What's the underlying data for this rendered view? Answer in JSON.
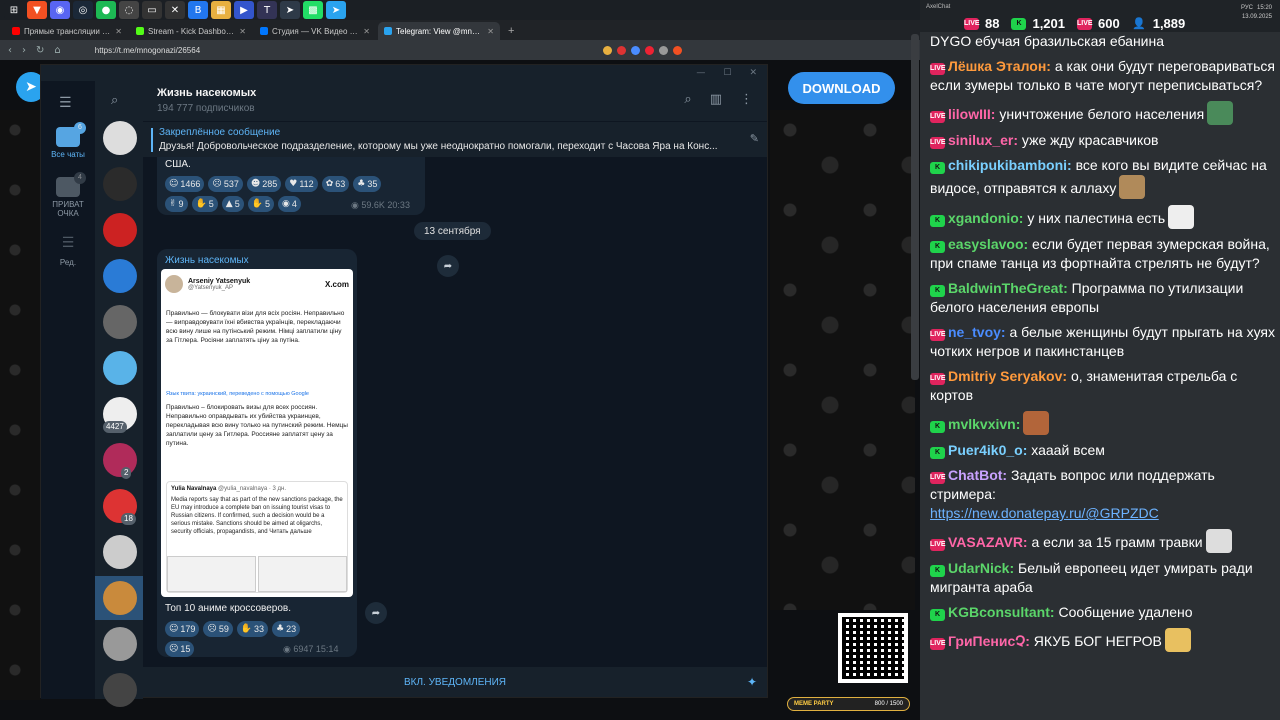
{
  "taskbar": {
    "icons": [
      {
        "name": "windows-icon",
        "glyph": "⊞",
        "color": "#1b1f24"
      },
      {
        "name": "brave-icon",
        "glyph": "▼",
        "color": "#f25022"
      },
      {
        "name": "discord-icon",
        "glyph": "◉",
        "color": "#5865f2"
      },
      {
        "name": "steam-icon",
        "glyph": "◎",
        "color": "#1b2838"
      },
      {
        "name": "spotify-icon",
        "glyph": "●",
        "color": "#1db954"
      },
      {
        "name": "obs-icon",
        "glyph": "◌",
        "color": "#444"
      },
      {
        "name": "window-icon",
        "glyph": "▭",
        "color": "#333"
      },
      {
        "name": "app-x-icon",
        "glyph": "✕",
        "color": "#333"
      },
      {
        "name": "app-b-icon",
        "glyph": "B",
        "color": "#2277ee"
      },
      {
        "name": "app-folder-icon",
        "glyph": "▦",
        "color": "#e8b040"
      },
      {
        "name": "app-arrow-icon",
        "glyph": "▶",
        "color": "#3355cc"
      },
      {
        "name": "app-t-icon",
        "glyph": "T",
        "color": "#335"
      },
      {
        "name": "telegram-icon",
        "glyph": "➤",
        "color": "#2aa3ef"
      },
      {
        "name": "app-grid-icon",
        "glyph": "▩",
        "color": "#2d6"
      },
      {
        "name": "telegram-2-icon",
        "glyph": "➤",
        "color": "#2aa3ef"
      }
    ]
  },
  "browser": {
    "tabs": [
      {
        "label": "Прямые трансляции - YouTube Studio",
        "color": "#ff0000",
        "active": false
      },
      {
        "label": "Stream - Kick Dashboard",
        "color": "#53fc18",
        "active": false
      },
      {
        "label": "Студия — VK Видео Live",
        "color": "#0077ff",
        "active": false
      },
      {
        "label": "Telegram: View @mnogonazi",
        "color": "#2aa3ef",
        "active": true
      }
    ],
    "new_tab": "+",
    "url": "https://t.me/mnogonazi/26564",
    "back": "‹",
    "forward": "›",
    "reload": "↻",
    "home": "⌂"
  },
  "page": {
    "download_label": "DOWNLOAD",
    "meme_party": "MEME PARTY",
    "meme_count": "800 / 1500"
  },
  "telegram": {
    "window_controls": {
      "minimize": "—",
      "maximize": "☐",
      "close": "✕"
    },
    "rail": {
      "menu": "☰",
      "items": [
        {
          "label": "Все чаты",
          "badge": "6",
          "active": true
        },
        {
          "label": "ПРИВАТ ОЧКА",
          "badge": "4",
          "active": false
        },
        {
          "label": "Ред.",
          "badge": "",
          "active": false
        }
      ]
    },
    "chat_list": {
      "search": "⌕",
      "avatars": [
        {
          "color": "#ddd",
          "badge": ""
        },
        {
          "color": "#2b2b2b",
          "badge": ""
        },
        {
          "color": "#c22",
          "badge": ""
        },
        {
          "color": "#2a7bd6",
          "badge": ""
        },
        {
          "color": "#666",
          "badge": ""
        },
        {
          "color": "#59b3e8",
          "badge": ""
        },
        {
          "color": "#eee",
          "badge": "4427"
        },
        {
          "color": "#b02b5a",
          "badge": "2"
        },
        {
          "color": "#d33",
          "badge": "18"
        },
        {
          "color": "#ccc",
          "badge": ""
        },
        {
          "color": "#c98a3c",
          "badge": ""
        },
        {
          "color": "#999",
          "badge": ""
        },
        {
          "color": "#444",
          "badge": ""
        }
      ]
    },
    "header": {
      "title": "Жизнь насекомых",
      "subscribers": "194 777 подписчиков",
      "search": "⌕",
      "columns": "▥",
      "more": "⋮"
    },
    "pinned": {
      "title": "Закреплённое сообщение",
      "text": "Друзья!  Добровольческое подразделение, которому мы уже неоднократно помогали, переходит с Часова Яра на Конс...",
      "icon": "✎"
    },
    "msg1": {
      "text": "США.",
      "reactions_row1": [
        {
          "emoji": "☺",
          "count": "1466"
        },
        {
          "emoji": "☹",
          "count": "537"
        },
        {
          "emoji": "☻",
          "count": "285"
        },
        {
          "emoji": "♥",
          "count": "112"
        },
        {
          "emoji": "✿",
          "count": "63"
        },
        {
          "emoji": "♣",
          "count": "35"
        }
      ],
      "reactions_row2": [
        {
          "emoji": "✌",
          "count": "9"
        },
        {
          "emoji": "✋",
          "count": "5"
        },
        {
          "emoji": "▲",
          "count": "5"
        },
        {
          "emoji": "✋",
          "count": "5"
        },
        {
          "emoji": "◉",
          "count": "4"
        }
      ],
      "views": "59.6K",
      "time": "20:33",
      "forward": "➦"
    },
    "date": "13 сентября",
    "msg2": {
      "author": "Жизнь насекомых",
      "tweet": {
        "name": "Arseniy Yatsenyuk",
        "handle": "@Yatsenyuk_AP",
        "source": "X.com",
        "ua_text": "Правильно — блокувати візи для всіх росіян. Неправильно — виправдовувати їхні вбивства українців, перекладаючи всю вину лише на путінський режим. Німці заплатили ціну за Гітлера. Росіяни заплатять ціну за путіна.",
        "translate_note": "Язык твита: украинский, переведено с помощью Google",
        "ru_text": "Правильно – блокировать визы для всех россиян. Неправильно оправдывать их убийства украинцев, перекладывая всю вину только на путинский режим. Немцы заплатили цену за Гитлера. Россияне заплатят цену за путина.",
        "quote_name": "Yulia Navalnaya",
        "quote_handle": "@yulia_navalnaya · 3 дн.",
        "quote_text": "Media reports say that as part of the new sanctions package, the EU may introduce a complete ban on issuing tourist visas to Russian citizens. If confirmed, such a decision would be a serious mistake. Sanctions should be aimed at oligarchs, security officials, propagandists, and Читать дальше"
      },
      "caption": "Топ 10 аниме кроссоверов.",
      "reactions_row1": [
        {
          "emoji": "☺",
          "count": "179"
        },
        {
          "emoji": "☹",
          "count": "59"
        },
        {
          "emoji": "✋",
          "count": "33"
        },
        {
          "emoji": "♣",
          "count": "23"
        }
      ],
      "reactions_row2": [
        {
          "emoji": "☹",
          "count": "15"
        }
      ],
      "views": "6947",
      "time": "15:14",
      "forward": "➦"
    },
    "notify_label": "ВКЛ. УВЕДОМЛЕНИЯ",
    "gift": "✦"
  },
  "chatpanel": {
    "app_name": "AxelChat",
    "stats": [
      {
        "icon": "live",
        "value": "88"
      },
      {
        "icon": "kick",
        "value": "1,201"
      },
      {
        "icon": "live",
        "value": "600"
      },
      {
        "icon": "viewers",
        "value": "1,889"
      }
    ],
    "sys": {
      "lang": "РУС",
      "time": "15:20",
      "date": "13.09.2025"
    },
    "colors": {
      "live": "#e0245e",
      "kick": "#1fd34b",
      "link": "#6db3ff"
    },
    "messages": [
      {
        "platform": "",
        "nick": "",
        "nick_color": "#ffffff",
        "text": "DYGO ебучая бразильская ебанина",
        "emote": ""
      },
      {
        "platform": "live",
        "nick": "Лёшка Эталон:",
        "nick_color": "#ff9a3c",
        "text": " а как они будут переговариваться если зумеры только в чате могут переписываться?",
        "emote": ""
      },
      {
        "platform": "live",
        "nick": "lilowIII:",
        "nick_color": "#ff66a8",
        "text": " уничтожение белого населения",
        "emote": "#4a8a5a"
      },
      {
        "platform": "live",
        "nick": "sinilux_er:",
        "nick_color": "#ff66a8",
        "text": " уже жду красавчиков",
        "emote": ""
      },
      {
        "platform": "kick",
        "nick": "chikipukibamboni:",
        "nick_color": "#7ad0ff",
        "text": " все кого вы видите сейчас на видосе, отправятся к аллаху",
        "emote": "#b08a5a"
      },
      {
        "platform": "kick",
        "nick": "xgandonio:",
        "nick_color": "#5bd66a",
        "text": " у них палестина есть",
        "emote": "#eeeeee"
      },
      {
        "platform": "kick",
        "nick": "easyslavoo:",
        "nick_color": "#5bd66a",
        "text": " если будет первая зумерская война, при спаме танца из фортнайта стрелять не будут?",
        "emote": ""
      },
      {
        "platform": "kick",
        "nick": "BaldwinTheGreat:",
        "nick_color": "#5bd66a",
        "text": " Программа по утилизации белого населения европы",
        "emote": ""
      },
      {
        "platform": "live",
        "nick": "ne_tvoy:",
        "nick_color": "#4a8cff",
        "text": " а белые женщины будут прыгать на хуях чотких негров и пакинстанцев",
        "emote": ""
      },
      {
        "platform": "live",
        "nick": "Dmitriy Seryakov:",
        "nick_color": "#ff9a3c",
        "text": " о, знаменитая стрельба с кортов",
        "emote": ""
      },
      {
        "platform": "kick",
        "nick": "mvlkvxivn:",
        "nick_color": "#5bd66a",
        "text": "",
        "emote": "#b2653a"
      },
      {
        "platform": "kick",
        "nick": "Puer4ik0_o:",
        "nick_color": "#7ad0ff",
        "text": " хааай всем",
        "emote": ""
      },
      {
        "platform": "live",
        "nick": "ChatBot:",
        "nick_color": "#c9a2ff",
        "text": " Задать вопрос или поддержать стримера: ",
        "link": "https://new.donatepay.ru/@GRPZDC",
        "emote": ""
      },
      {
        "platform": "live",
        "nick": "VASAZAVR:",
        "nick_color": "#ff66a8",
        "text": " а если за 15 грамм травки",
        "emote": "#dddddd"
      },
      {
        "platform": "kick",
        "nick": "UdarNick:",
        "nick_color": "#5bd66a",
        "text": " Белый европеец идет умирать ради мигранта араба",
        "emote": ""
      },
      {
        "platform": "kick",
        "nick": "KGBconsultant:",
        "nick_color": "#5bd66a",
        "text": " Сообщение удалено",
        "emote": ""
      },
      {
        "platform": "live",
        "nick": "ГриПенисՉ:",
        "nick_color": "#ff66a8",
        "text": " ЯКУБ БОГ НЕГРОВ",
        "emote": "#e8c060"
      }
    ]
  }
}
